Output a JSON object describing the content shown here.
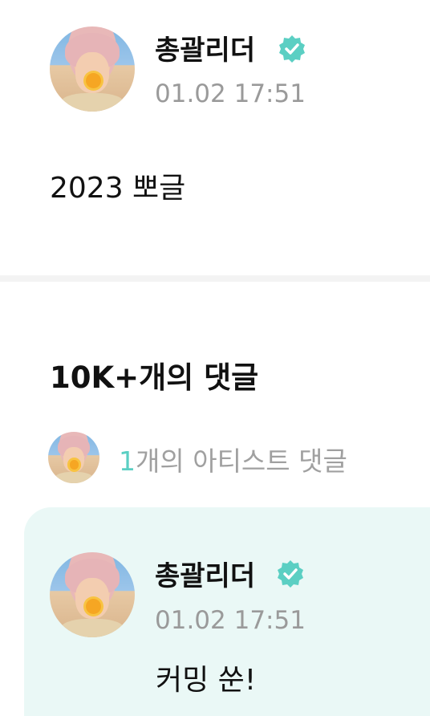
{
  "post": {
    "author": "총괄리더",
    "timestamp": "01.02 17:51",
    "body": "2023 뽀글"
  },
  "comments": {
    "header": "10K+개의 댓글",
    "artist_summary": {
      "count": "1",
      "label": "개의 아티스트 댓글"
    },
    "items": [
      {
        "author": "총괄리더",
        "timestamp": "01.02 17:51",
        "text": "커밍 쑨!"
      }
    ]
  },
  "colors": {
    "accent": "#5bcfc3",
    "verified_badge": "#5bcfc3",
    "artist_comment_bg": "#eaf8f6",
    "muted_text": "#9a9a9a"
  },
  "icons": [
    "verified-badge-icon"
  ]
}
